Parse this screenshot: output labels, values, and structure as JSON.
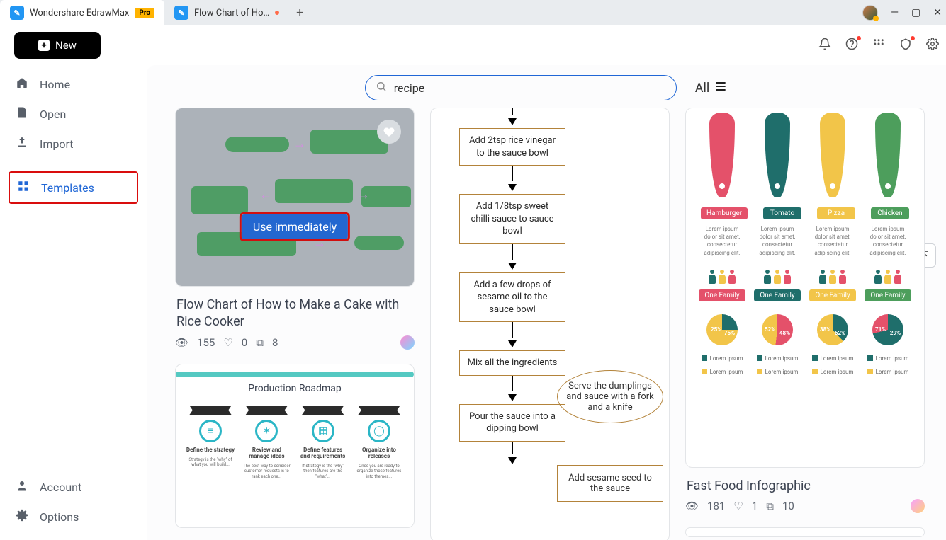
{
  "titlebar": {
    "tab1_label": "Wondershare EdrawMax",
    "pro_label": "Pro",
    "tab2_label": "Flow Chart of Ho…"
  },
  "toolbar": {
    "new_label": "New"
  },
  "sidebar": {
    "home": "Home",
    "open": "Open",
    "import": "Import",
    "templates": "Templates",
    "account": "Account",
    "options": "Options"
  },
  "search": {
    "value": "recipe",
    "filter_label": "All"
  },
  "cards": {
    "c1": {
      "title": "Flow Chart of How to Make a Cake with Rice Cooker",
      "views": "155",
      "likes": "0",
      "copies": "8",
      "use_label": "Use immediately"
    },
    "c2": {
      "thumb_title": "Production Roadmap",
      "steps": [
        "Define the strategy",
        "Review and manage ideas",
        "Define features and requirements",
        "Organize into releases"
      ]
    },
    "c3": {
      "n1": "Add 2tsp rice vinegar to the sauce bowl",
      "n2": "Add 1/8tsp sweet chilli sauce to sauce bowl",
      "n3": "Add a few drops of sesame oil to the sauce bowl",
      "n4": "Mix all the ingredients",
      "n5": "Pour the sauce into a dipping bowl",
      "side_ellipse": "Serve the dumplings and sauce with a fork and a knife",
      "side_box": "Add sesame seed to the sauce"
    },
    "c4": {
      "title": "Fast Food Infographic",
      "views": "181",
      "likes": "1",
      "copies": "10",
      "pills": [
        "Hamburger",
        "Tomato",
        "Pizza",
        "Chicken"
      ],
      "lorem": "Lorem ipsum dolor sit amet, consectetur adipiscing elit.",
      "family": "One Family",
      "lorem2": "Lorem ipsum",
      "donuts": [
        {
          "a": "25%",
          "b": "75%"
        },
        {
          "a": "52%",
          "b": "48%"
        },
        {
          "a": "38%",
          "b": "62%"
        },
        {
          "a": "71%",
          "b": "29%"
        }
      ]
    }
  }
}
